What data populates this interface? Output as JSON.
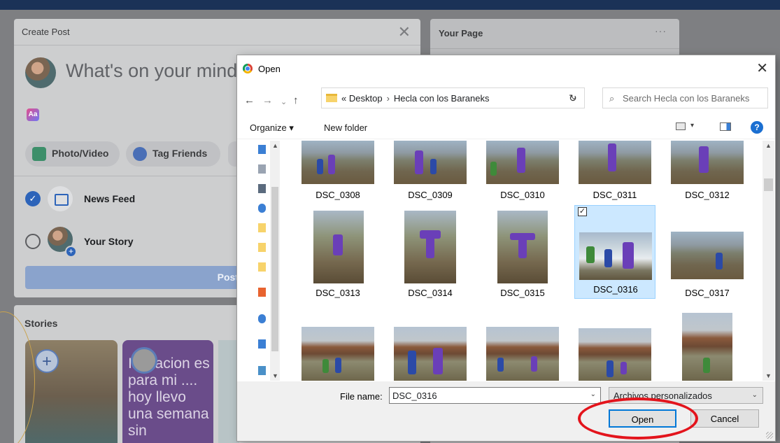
{
  "create_post": {
    "title": "Create Post",
    "close": "✕",
    "prompt": "What's on your mind",
    "aa_icon": "Aa",
    "chips": {
      "photo": "Photo/Video",
      "tag": "Tag Friends"
    },
    "news_feed": "News Feed",
    "your_story": "Your Story",
    "post": "Post"
  },
  "stories": {
    "title": "Stories",
    "plus": "+",
    "story2_text": "Invitacion es para mi .... hoy llevo una semana sin"
  },
  "your_page": {
    "title": "Your Page",
    "more": "···"
  },
  "dialog": {
    "title": "Open",
    "close": "✕",
    "nav": {
      "back": "←",
      "forward": "→",
      "dropdown": "⌄",
      "up": "↑",
      "refresh": "↻"
    },
    "breadcrumb": {
      "prefix": "«",
      "desktop": "Desktop",
      "sep": "›",
      "folder": "Hecla con los Baraneks"
    },
    "search_placeholder": "Search Hecla con los Baraneks",
    "toolbar": {
      "organize": "Organize ▾",
      "new_folder": "New folder",
      "help": "?"
    },
    "files": [
      "DSC_0308",
      "DSC_0309",
      "DSC_0310",
      "DSC_0311",
      "DSC_0312",
      "DSC_0313",
      "DSC_0314",
      "DSC_0315",
      "DSC_0316",
      "DSC_0317"
    ],
    "selected_file": "DSC_0316",
    "checkmark": "✓",
    "file_name_label": "File name:",
    "file_name_value": "DSC_0316",
    "filter": "Archivos personalizados",
    "open_button": "Open",
    "cancel_button": "Cancel"
  },
  "colors": {
    "accent_blue": "#0078d7",
    "facebook_blue": "#2d64b9",
    "annotation_red": "#e3141c",
    "selection": "#cce8ff"
  },
  "icons": [
    "chrome-icon",
    "close-icon",
    "back-arrow-icon",
    "forward-arrow-icon",
    "up-arrow-icon",
    "refresh-icon",
    "search-icon",
    "folder-icon",
    "help-icon",
    "view-icon",
    "preview-pane-icon"
  ]
}
